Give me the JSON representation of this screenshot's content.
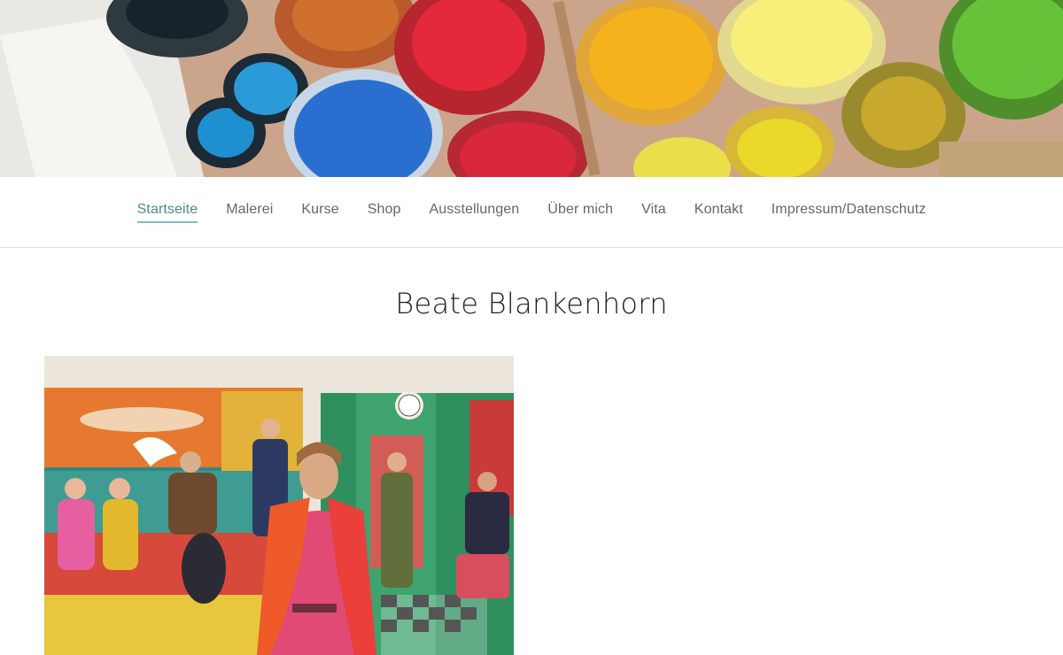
{
  "navigation": {
    "items": [
      {
        "label": "Startseite",
        "active": true
      },
      {
        "label": "Malerei"
      },
      {
        "label": "Kurse"
      },
      {
        "label": "Shop"
      },
      {
        "label": "Ausstellungen"
      },
      {
        "label": "Über mich"
      },
      {
        "label": "Vita"
      },
      {
        "label": "Kontakt"
      },
      {
        "label": "Impressum/Datenschutz"
      }
    ]
  },
  "main": {
    "title": "Beate Blankenhorn"
  },
  "colors": {
    "nav_active_underline": "#7cc0bd",
    "nav_text": "#666666",
    "title_text": "#222222"
  }
}
